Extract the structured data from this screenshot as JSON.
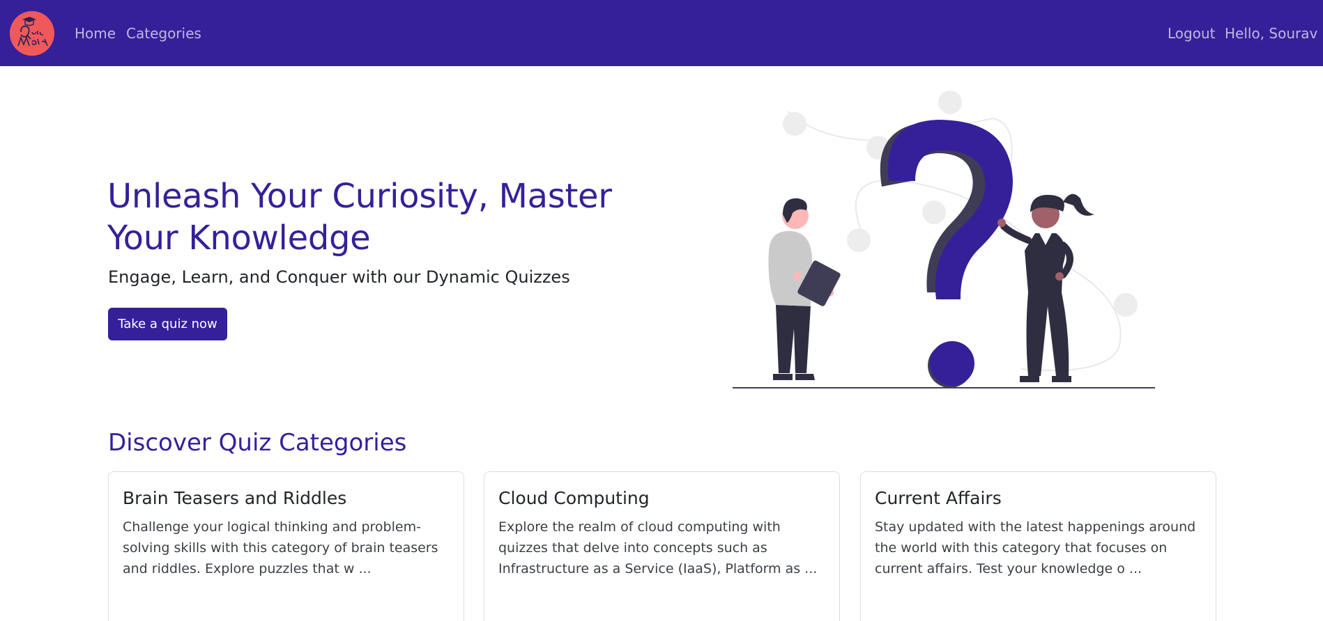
{
  "navbar": {
    "logo_alt": "Quiz Master",
    "links": [
      {
        "label": "Home"
      },
      {
        "label": "Categories"
      }
    ],
    "logout_label": "Logout",
    "greeting": "Hello, Sourav"
  },
  "hero": {
    "title": "Unleash Your Curiosity, Master Your Knowledge",
    "subtitle": "Engage, Learn, and Conquer with our Dynamic Quizzes",
    "cta_label": "Take a quiz now",
    "illustration_icon": "question-mark-people-illustration"
  },
  "categories_section": {
    "title": "Discover Quiz Categories",
    "cards": [
      {
        "title": "Brain Teasers and Riddles",
        "description": "Challenge your logical thinking and problem-solving skills with this category of brain teasers and riddles. Explore puzzles that w ..."
      },
      {
        "title": "Cloud Computing",
        "description": "Explore the realm of cloud computing with quizzes that delve into concepts such as Infrastructure as a Service (IaaS), Platform as ..."
      },
      {
        "title": "Current Affairs",
        "description": "Stay updated with the latest happenings around the world with this category that focuses on current affairs. Test your knowledge o ..."
      }
    ]
  },
  "colors": {
    "brand": "#35209a",
    "logo_bg": "#f0595a",
    "text_dark": "#212529"
  }
}
